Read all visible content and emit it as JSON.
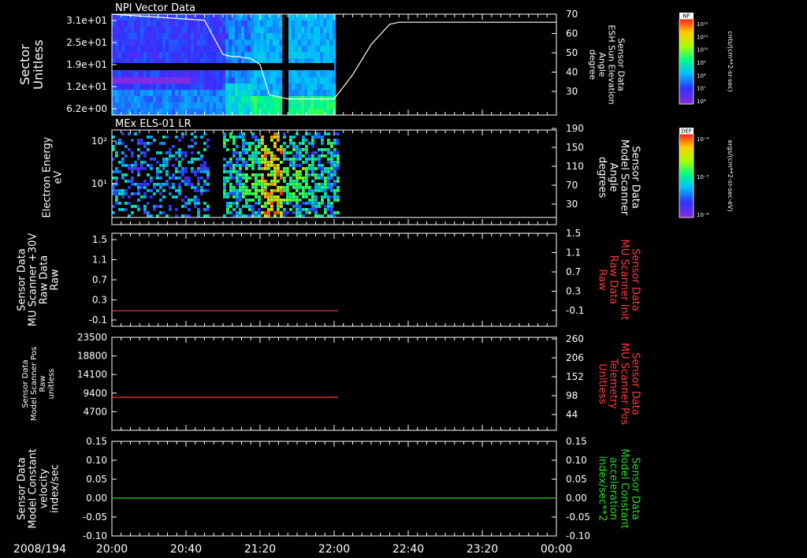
{
  "colors": {
    "background": "#000000",
    "axis": "#ffffff",
    "red_trace": "#ff3a3a",
    "green_trace": "#22dd22"
  },
  "time_axis": {
    "date_label": "2008/194",
    "ticks": [
      "20:00",
      "20:40",
      "21:20",
      "22:00",
      "22:40",
      "23:20",
      "00:00"
    ],
    "data_end": "22:02"
  },
  "panels": [
    {
      "title": "NPI Vector Data",
      "left_label": [
        "Sector",
        "Unitless"
      ],
      "left_ticks": [
        "3.1e+01",
        "2.5e+01",
        "1.9e+01",
        "1.2e+01",
        "6.2e+00"
      ],
      "right_label": [
        "Sensor Data",
        "ESH Sun Elevation",
        "Angle",
        "degree"
      ],
      "right_ticks": [
        "70",
        "60",
        "50",
        "40",
        "30"
      ],
      "right_label_color": "#ffffff",
      "colorbar": {
        "tag": "NF",
        "unit": "cnts/(cm**2-sr-sec)",
        "ticks": [
          "10¹²",
          "10¹¹",
          "10¹⁰",
          "10⁹",
          "10⁸",
          "10⁷",
          "10⁶"
        ]
      }
    },
    {
      "title": "MEx ELS-01 LR",
      "left_label": [
        "Electron Energy",
        "eV"
      ],
      "left_ticks": [
        "10²",
        "10¹"
      ],
      "right_label": [
        "Sensor Data",
        "Model Scanner",
        "Angle",
        "degrees"
      ],
      "right_ticks": [
        "190",
        "150",
        "110",
        "70",
        "30"
      ],
      "right_label_color": "#ffffff",
      "colorbar": {
        "tag": "DEF",
        "unit": "ergs/(cm**2-sr-sec-eV)",
        "ticks": [
          "10⁻⁴",
          "10⁻⁵",
          "10⁻⁶"
        ]
      }
    },
    {
      "title": "",
      "left_label": [
        "Sensor Data",
        "MU Scanner +30V",
        "Raw Data",
        "Raw"
      ],
      "left_ticks": [
        "1.5",
        "1.1",
        "0.7",
        "0.3",
        "-0.1"
      ],
      "right_label": [
        "Sensor Data",
        "MU Scanner Init",
        "Raw Data",
        "Raw"
      ],
      "right_ticks": [
        "1.5",
        "1.1",
        "0.7",
        "0.3",
        "-0.1"
      ],
      "right_label_color": "#ff3a3a"
    },
    {
      "title": "",
      "left_label": [
        "Sensor Data",
        "Model Scanner Pos",
        "Raw",
        "unitless"
      ],
      "left_ticks": [
        "23500",
        "18800",
        "14100",
        "9400",
        "4700"
      ],
      "right_label": [
        "Sensor Data",
        "MU Scanner Pos",
        "Telemetry",
        "Unitless"
      ],
      "right_ticks": [
        "260",
        "206",
        "152",
        "98",
        "44"
      ],
      "right_label_color": "#ff3a3a"
    },
    {
      "title": "",
      "left_label": [
        "Sensor Data",
        "Model Constant",
        "velocity",
        "index/sec"
      ],
      "left_ticks": [
        "0.15",
        "0.10",
        "0.05",
        "0.00",
        "-0.05",
        "-0.10"
      ],
      "right_label": [
        "Sensor Data",
        "Model Constant",
        "acceleration",
        "index/sec**2"
      ],
      "right_ticks": [
        "0.15",
        "0.10",
        "0.05",
        "0.00",
        "-0.05",
        "-0.10"
      ],
      "right_label_color": "#22dd22"
    }
  ],
  "chart_data": [
    {
      "type": "heatmap",
      "title": "NPI Vector Data",
      "ylabel": "Sector Unitless",
      "ylim": [
        0,
        31
      ],
      "overlay_line": {
        "name": "Sensor Data ESH Sun Elevation Angle",
        "ylim": [
          20,
          70
        ],
        "x": [
          "20:00",
          "20:50",
          "21:00",
          "21:05",
          "21:08",
          "21:15",
          "21:20",
          "21:25",
          "21:35",
          "21:45",
          "21:50",
          "22:00",
          "22:10",
          "22:20",
          "22:30",
          "22:35",
          "00:00"
        ],
        "y": [
          70,
          67,
          50,
          49,
          49,
          48,
          45,
          30,
          28,
          28,
          28,
          28,
          40,
          55,
          65,
          66,
          66
        ]
      }
    },
    {
      "type": "heatmap",
      "title": "MEx ELS-01 LR",
      "ylabel": "Electron Energy eV",
      "yscale": "log",
      "overlay_line": {
        "name": "Sensor Data Model Scanner Angle",
        "ylim": [
          0,
          190
        ],
        "x": [
          "20:00",
          "00:00"
        ],
        "y": [
          5,
          5
        ]
      }
    },
    {
      "type": "line",
      "ylim": [
        -0.3,
        1.5
      ],
      "series": [
        {
          "name": "Sensor Data MU Scanner Init Raw Data Raw",
          "x": [
            "20:00",
            "22:02"
          ],
          "values": [
            0.0,
            0.0
          ]
        }
      ]
    },
    {
      "type": "line",
      "ylim": [
        0,
        23500
      ],
      "series": [
        {
          "name": "Sensor Data MU Scanner Pos Telemetry Unitless",
          "x": [
            "20:00",
            "22:02"
          ],
          "values": [
            8340,
            8340
          ]
        }
      ]
    },
    {
      "type": "line",
      "ylim": [
        -0.1,
        0.15
      ],
      "series": [
        {
          "name": "Sensor Data Model Constant acceleration index/sec**2",
          "x": [
            "20:00",
            "00:00"
          ],
          "values": [
            0.0,
            0.0
          ]
        }
      ]
    }
  ]
}
